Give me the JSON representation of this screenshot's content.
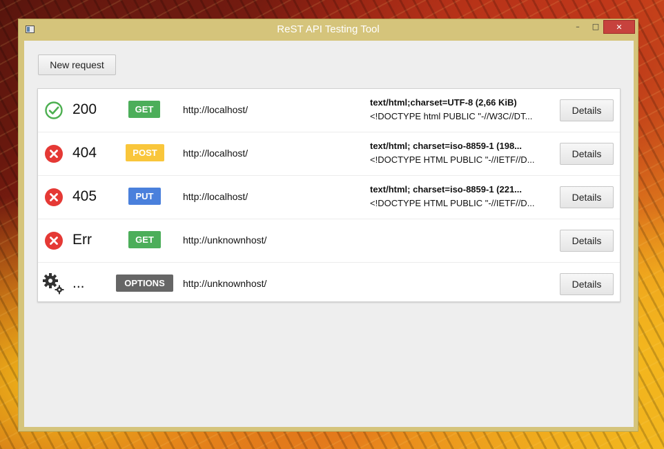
{
  "window": {
    "title": "ReST API Testing Tool",
    "minimize_label": "–",
    "maximize_label": "□",
    "close_label": "✕"
  },
  "toolbar": {
    "new_request_label": "New request"
  },
  "colors": {
    "success": "#4caf50",
    "error": "#e53935",
    "get": "#4cae5a",
    "post": "#f9c63b",
    "put": "#4a80dc",
    "options": "#666666"
  },
  "requests": [
    {
      "status_icon": "check-circle-icon",
      "code": "200",
      "method": "GET",
      "url": "http://localhost/",
      "content_type": "text/html;charset=UTF-8  (2,66 KiB)",
      "preview": "<!DOCTYPE html PUBLIC \"-//W3C//DT...",
      "details_label": "Details"
    },
    {
      "status_icon": "error-circle-icon",
      "code": "404",
      "method": "POST",
      "url": "http://localhost/",
      "content_type": "text/html; charset=iso-8859-1  (198...",
      "preview": "<!DOCTYPE HTML PUBLIC \"-//IETF//D...",
      "details_label": "Details"
    },
    {
      "status_icon": "error-circle-icon",
      "code": "405",
      "method": "PUT",
      "url": "http://localhost/",
      "content_type": "text/html; charset=iso-8859-1  (221...",
      "preview": "<!DOCTYPE HTML PUBLIC \"-//IETF//D...",
      "details_label": "Details"
    },
    {
      "status_icon": "error-circle-icon",
      "code": "Err",
      "method": "GET",
      "url": "http://unknownhost/",
      "content_type": "",
      "preview": "",
      "details_label": "Details"
    },
    {
      "status_icon": "gears-icon",
      "code": "...",
      "method": "OPTIONS",
      "url": "http://unknownhost/",
      "content_type": "",
      "preview": "",
      "details_label": "Details"
    }
  ]
}
